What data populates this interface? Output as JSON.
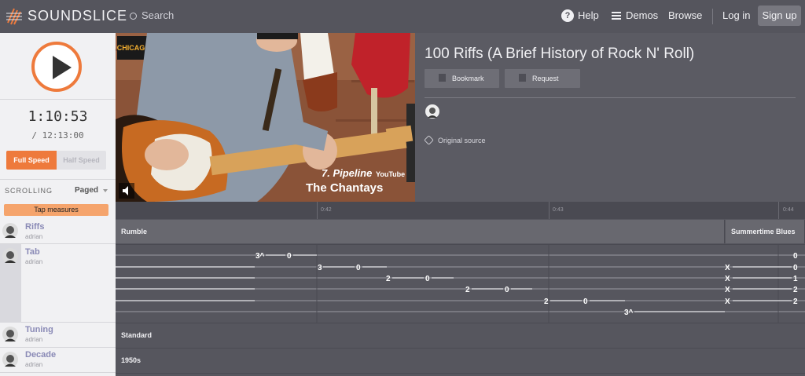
{
  "header": {
    "brand": "SOUNDSLICE",
    "search_label": "Search",
    "help": "Help",
    "demos": "Demos",
    "browse": "Browse",
    "login": "Log in",
    "signup": "Sign up"
  },
  "player": {
    "current_time": "1:10:53",
    "total_time": "/ 12:13:00",
    "speed_full": "Full Speed",
    "speed_half": "Half Speed",
    "scrolling_label": "SCROLLING",
    "scrolling_value": "Paged",
    "tap_measures": "Tap measures"
  },
  "video": {
    "caption_line1": "7. Pipeline",
    "caption_line2": "The Chantays",
    "youtube": "YouTube",
    "amp_sign": "CHICAGO"
  },
  "info": {
    "title": "100 Riffs (A Brief History of Rock N' Roll)",
    "bookmark": "Bookmark",
    "request": "Request",
    "original_source": "Original source"
  },
  "timeline": {
    "labels": [
      "0:42",
      "0:43",
      "0:44"
    ]
  },
  "tracks": [
    {
      "name": "Riffs",
      "user": "adrian"
    },
    {
      "name": "Tab",
      "user": "adrian"
    },
    {
      "name": "Tuning",
      "user": "adrian"
    },
    {
      "name": "Decade",
      "user": "adrian"
    }
  ],
  "riffs_sections": [
    "Rumble",
    "Summertime Blues"
  ],
  "tab_notes": {
    "string1": [
      "3^",
      "0",
      "0"
    ],
    "string2": [
      "3",
      "0",
      "X",
      "0"
    ],
    "string3": [
      "2",
      "0",
      "X",
      "1"
    ],
    "string4": [
      "2",
      "0",
      "X",
      "2"
    ],
    "string5": [
      "2",
      "0",
      "X",
      "2"
    ],
    "string6": [
      "3^"
    ]
  },
  "tuning_value": "Standard",
  "decade_value": "1950s",
  "colors": {
    "accent": "#ee7a3c",
    "tap_button": "#f5a46c",
    "header_bg": "#55555d",
    "score_bg": "#56565e"
  }
}
